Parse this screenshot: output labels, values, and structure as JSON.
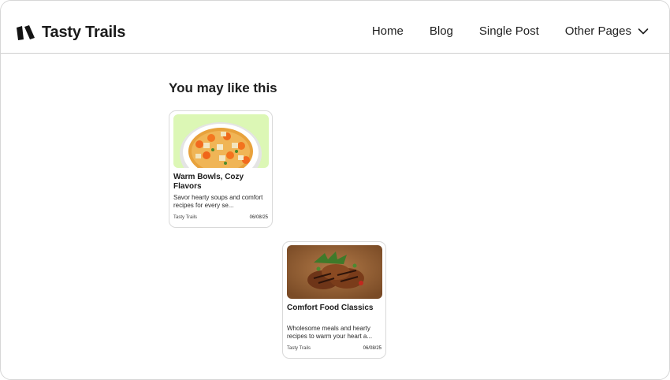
{
  "brand": {
    "name": "Tasty Trails"
  },
  "nav": {
    "items": [
      "Home",
      "Blog",
      "Single Post"
    ],
    "dropdown_label": "Other Pages"
  },
  "section": {
    "title": "You may like this"
  },
  "posts": [
    {
      "title": "Warm Bowls, Cozy Flavors",
      "description": "Savor hearty soups and comfort recipes for every se...",
      "author": "Tasty Trails",
      "date": "06/08/25",
      "image": "vegetable-soup-bowl"
    },
    {
      "title": "Comfort Food Classics",
      "description": "Wholesome meals and hearty recipes to warm your heart a...",
      "author": "Tasty Trails",
      "date": "06/08/25",
      "image": "grilled-chicken"
    }
  ],
  "icons": {
    "dropdown": "chevron-down-icon",
    "logo": "logo-icon"
  },
  "colors": {
    "accent_green": "#dcf7b5",
    "text": "#1f1f1f",
    "border": "#d9d9d9"
  }
}
